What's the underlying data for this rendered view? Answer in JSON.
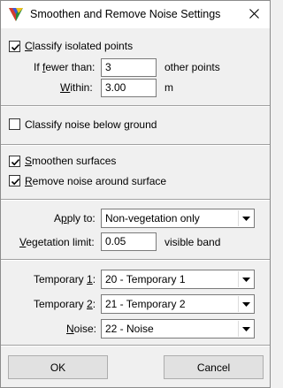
{
  "window": {
    "title": "Smoothen and Remove Noise Settings"
  },
  "icons": {
    "app": "triangle-logo-icon",
    "close": "close-icon",
    "dropdown": "chevron-down-icon",
    "check": "checkmark-icon"
  },
  "isolated": {
    "classify_label_u": "C",
    "classify_label_rest": "lassify isolated points",
    "classify_checked": true,
    "fewer_label_pre": "If ",
    "fewer_label_u": "f",
    "fewer_label_rest": "ewer than:",
    "fewer_value": "3",
    "fewer_suffix": "other points",
    "within_label_u": "W",
    "within_label_rest": "ithin:",
    "within_value": "3.00",
    "within_suffix": "m"
  },
  "ground": {
    "label_pre": "Classify noise below ",
    "label_u": "g",
    "label_rest": "round",
    "checked": false
  },
  "surfaces": {
    "smoothen_u": "S",
    "smoothen_rest": "moothen surfaces",
    "smoothen_checked": true,
    "remove_u": "R",
    "remove_rest": "emove noise around surface",
    "remove_checked": true
  },
  "apply": {
    "apply_label_pre": "A",
    "apply_label_u": "p",
    "apply_label_rest": "ply to:",
    "apply_value": "Non-vegetation only",
    "veg_label_u": "V",
    "veg_label_rest": "egetation limit:",
    "veg_value": "0.05",
    "veg_suffix": "visible band"
  },
  "classes": {
    "temp1_label_pre": "Temporary ",
    "temp1_label_u": "1",
    "temp1_label_rest": ":",
    "temp1_value": "20 - Temporary 1",
    "temp2_label_pre": "Temporary ",
    "temp2_label_u": "2",
    "temp2_label_rest": ":",
    "temp2_value": "21 - Temporary 2",
    "noise_label_u": "N",
    "noise_label_rest": "oise:",
    "noise_value": "22 - Noise"
  },
  "buttons": {
    "ok": "OK",
    "cancel": "Cancel"
  }
}
